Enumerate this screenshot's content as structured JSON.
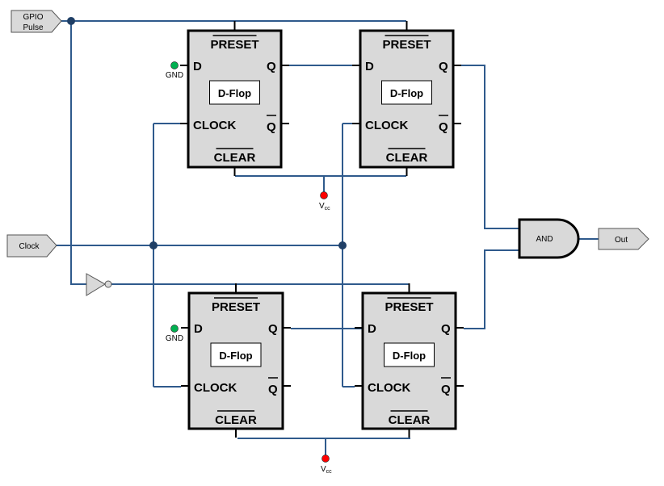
{
  "inputs": {
    "gpio_line1": "GPIO",
    "gpio_line2": "Pulse",
    "clock": "Clock"
  },
  "output": {
    "label": "Out"
  },
  "gate": {
    "label": "AND"
  },
  "flipflop": {
    "title": "D-Flop",
    "preset": "PRESET",
    "clear": "CLEAR",
    "d": "D",
    "q": "Q",
    "qbar": "Q",
    "clock": "CLOCK"
  },
  "supplies": {
    "gnd": "GND",
    "vcc_main": "V",
    "vcc_sub": "cc"
  },
  "colors": {
    "wire": "#2f5a8c",
    "gnd_dot": "#00b050",
    "vcc_dot": "#ff0000",
    "junction": "#1f3f66",
    "block_fill": "#d9d9d9"
  }
}
